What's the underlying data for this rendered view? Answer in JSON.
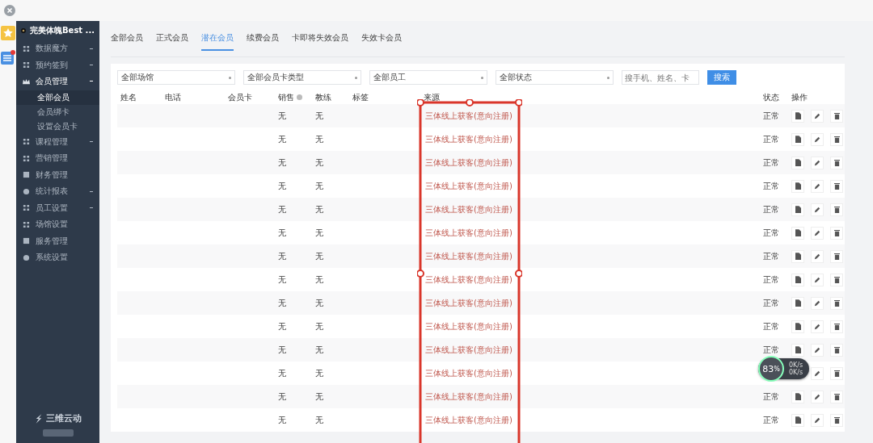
{
  "app_title": "完美体魄Best ...",
  "sidebar": {
    "items": [
      {
        "label": "数据魔方",
        "expanded": false
      },
      {
        "label": "预约签到",
        "expanded": false
      },
      {
        "label": "会员管理",
        "expanded": true,
        "selected": true,
        "children": [
          {
            "label": "全部会员",
            "selected": true
          },
          {
            "label": "会员绑卡",
            "selected": false
          },
          {
            "label": "设置会员卡",
            "selected": false
          }
        ]
      },
      {
        "label": "课程管理",
        "expanded": false
      },
      {
        "label": "营销管理"
      },
      {
        "label": "财务管理"
      },
      {
        "label": "统计报表",
        "expanded": false
      },
      {
        "label": "员工设置",
        "expanded": false
      },
      {
        "label": "场馆设置"
      },
      {
        "label": "服务管理"
      },
      {
        "label": "系统设置"
      }
    ],
    "brand": "三维云动"
  },
  "tabs": [
    {
      "label": "全部会员",
      "selected": false
    },
    {
      "label": "正式会员",
      "selected": false
    },
    {
      "label": "潜在会员",
      "selected": true
    },
    {
      "label": "续费会员",
      "selected": false
    },
    {
      "label": "卡即将失效会员",
      "selected": false
    },
    {
      "label": "失效卡会员",
      "selected": false
    }
  ],
  "filters": [
    "全部场馆",
    "全部会员卡类型",
    "全部员工",
    "全部状态"
  ],
  "search": {
    "placeholder": "搜手机、姓名、卡"
  },
  "search_button": "搜索",
  "table": {
    "columns": [
      "姓名",
      "电话",
      "会员卡",
      "销售",
      "教练",
      "标签",
      "来源",
      "状态",
      "操作"
    ],
    "rows": [
      {
        "sales": "无",
        "coach": "无",
        "source": "三体线上获客(意向注册)",
        "status": "正常"
      },
      {
        "sales": "无",
        "coach": "无",
        "source": "三体线上获客(意向注册)",
        "status": "正常"
      },
      {
        "sales": "无",
        "coach": "无",
        "source": "三体线上获客(意向注册)",
        "status": "正常"
      },
      {
        "sales": "无",
        "coach": "无",
        "source": "三体线上获客(意向注册)",
        "status": "正常"
      },
      {
        "sales": "无",
        "coach": "无",
        "source": "三体线上获客(意向注册)",
        "status": "正常"
      },
      {
        "sales": "无",
        "coach": "无",
        "source": "三体线上获客(意向注册)",
        "status": "正常"
      },
      {
        "sales": "无",
        "coach": "无",
        "source": "三体线上获客(意向注册)",
        "status": "正常"
      },
      {
        "sales": "无",
        "coach": "无",
        "source": "三体线上获客(意向注册)",
        "status": "正常"
      },
      {
        "sales": "无",
        "coach": "无",
        "source": "三体线上获客(意向注册)",
        "status": "正常"
      },
      {
        "sales": "无",
        "coach": "无",
        "source": "三体线上获客(意向注册)",
        "status": "正常"
      },
      {
        "sales": "无",
        "coach": "无",
        "source": "三体线上获客(意向注册)",
        "status": "正常"
      },
      {
        "sales": "无",
        "coach": "无",
        "source": "三体线上获客(意向注册)"
      },
      {
        "sales": "无",
        "coach": "无",
        "source": "三体线上获客(意向注册)",
        "status": "正常"
      },
      {
        "sales": "无",
        "coach": "无",
        "source": "三体线上获客(意向注册)",
        "status": "正常"
      }
    ]
  },
  "speed_widget": {
    "percent": "83",
    "unit": "%",
    "up": "0K/s",
    "down": "0K/s"
  }
}
